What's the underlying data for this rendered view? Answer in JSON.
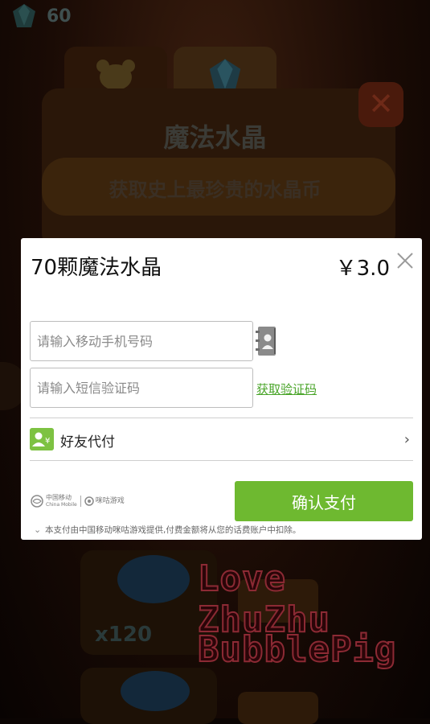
{
  "background": {
    "gem_count": "60",
    "title": "魔法水晶",
    "subtitle": "获取史上最珍贵的水晶币",
    "pack_label": "x120",
    "watermark_line1": "Love ZhuZhu",
    "watermark_line2": "BubblePig"
  },
  "dialog": {
    "title": "70颗魔法水晶",
    "price": "￥3.0",
    "phone_placeholder": "请输入移动手机号码",
    "code_placeholder": "请输入短信验证码",
    "get_code_label": "获取验证码",
    "friend_pay_label": "好友代付",
    "confirm_label": "确认支付",
    "logo_cmcc": "中国移动",
    "logo_cmcc_en": "China Mobile",
    "logo_migu": "咪咕游戏",
    "footnote": "本支付由中国移动咪咕游戏提供,付费金额将从您的话费账户中扣除。"
  },
  "colors": {
    "accent": "#6eb930",
    "link": "#4aa52a",
    "watermark_outline": "#8c2a34"
  },
  "icons": {
    "close": "close-icon",
    "contacts": "contacts-book-icon",
    "friend": "friend-pay-icon",
    "chevron": "chevron-right-icon"
  }
}
